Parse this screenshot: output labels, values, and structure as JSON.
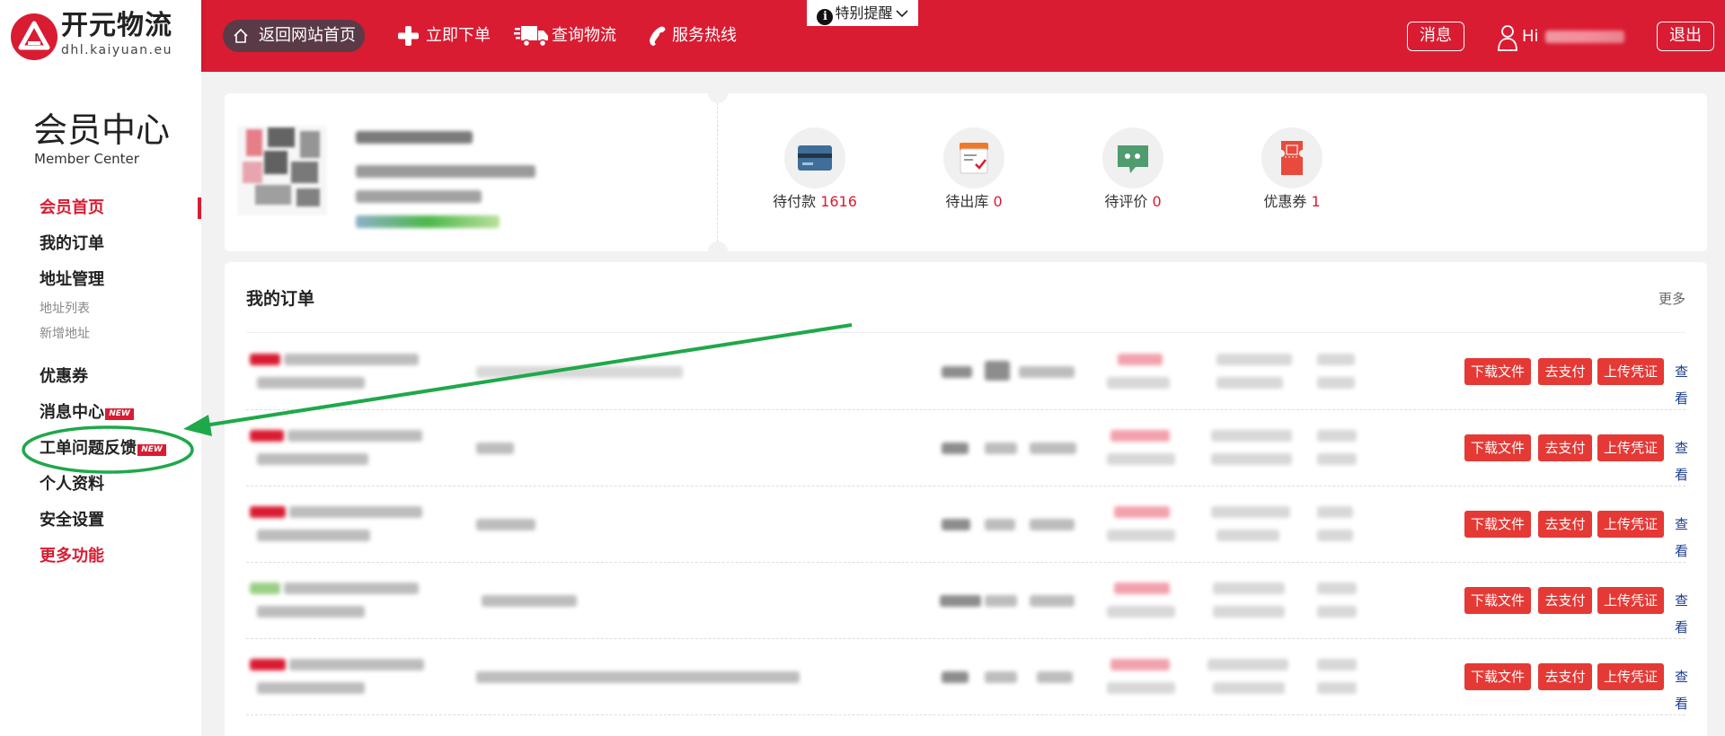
{
  "header": {
    "logo_name": "开元物流",
    "logo_domain": "dhl.kaiyuan.eu",
    "nav_home": "返回网站首页",
    "nav_order": "立即下单",
    "nav_track": "查询物流",
    "nav_hotline": "服务热线",
    "notice": "特别提醒",
    "messages": "消息",
    "greeting": "Hi",
    "logout": "退出"
  },
  "sidebar": {
    "title": "会员中心",
    "subtitle": "Member Center",
    "items": {
      "home": "会员首页",
      "orders": "我的订单",
      "address": "地址管理",
      "address_list": "地址列表",
      "address_new": "新增地址",
      "coupons": "优惠券",
      "messages": "消息中心",
      "tickets": "工单问题反馈",
      "profile": "个人资料",
      "security": "安全设置",
      "more": "更多功能"
    },
    "new_badge": "NEW"
  },
  "stats": [
    {
      "label": "待付款",
      "value": "1616"
    },
    {
      "label": "待出库",
      "value": "0"
    },
    {
      "label": "待评价",
      "value": "0"
    },
    {
      "label": "优惠券",
      "value": "1"
    }
  ],
  "orders": {
    "title": "我的订单",
    "more": "更多",
    "actions": {
      "download": "下载文件",
      "pay": "去支付",
      "upload": "上传凭证",
      "view": "查看"
    }
  },
  "colors": {
    "brand_red": "#d91c32",
    "action_red": "#e53935",
    "annotation_green": "#1fa84a"
  }
}
